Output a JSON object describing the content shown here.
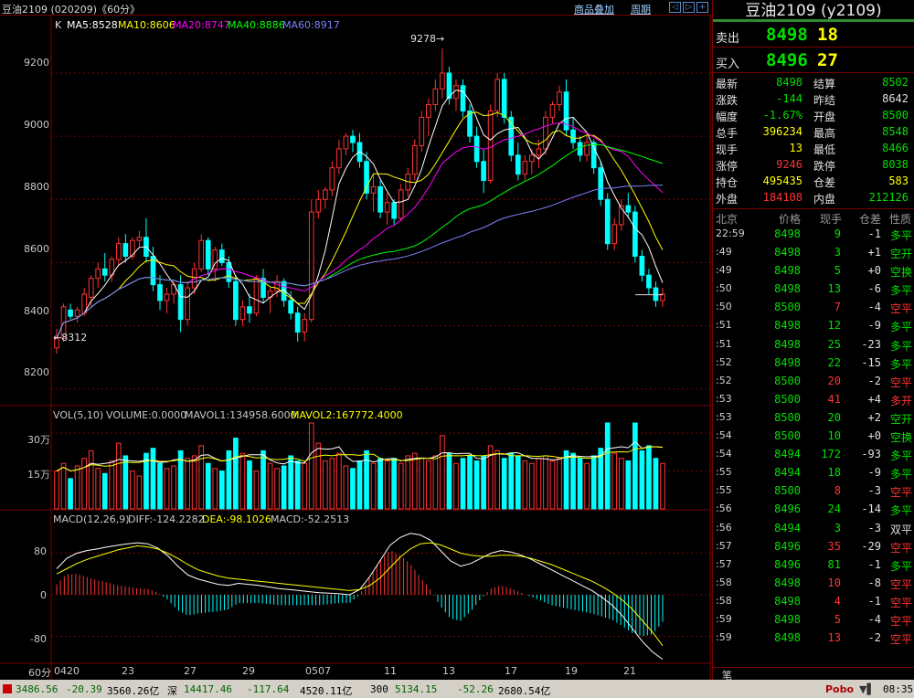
{
  "window": {
    "symbol_line": "豆油2109 (020209)《60分》",
    "menu": [
      "商品叠加",
      "周期"
    ],
    "nav_buttons": [
      "◁",
      "▷",
      "+",
      "−",
      "⊡"
    ]
  },
  "price_chart": {
    "type_label": "K",
    "ma_labels": [
      {
        "text": "MA5:8528",
        "color": "#ffffff"
      },
      {
        "text": "MA10:8606",
        "color": "#ffff00"
      },
      {
        "text": "MA20:8747",
        "color": "#ff00ff"
      },
      {
        "text": "MA40:8886",
        "color": "#00ff00"
      },
      {
        "text": "MA60:8917",
        "color": "#8080ff"
      }
    ],
    "y_ticks": [
      "9200",
      "9000",
      "8800",
      "8600",
      "8400",
      "8200"
    ],
    "high_marker": "9278→",
    "low_marker": "←8312"
  },
  "volume_chart": {
    "labels": [
      {
        "text": "VOL(5,10)",
        "color": "#e0e0e0"
      },
      {
        "text": "VOLUME:0.0000",
        "color": "#e0e0e0"
      },
      {
        "text": "MAVOL1:134958.6000",
        "color": "#e0e0e0"
      },
      {
        "text": "MAVOL2:167772.4000",
        "color": "#ffff00"
      }
    ],
    "y_ticks": [
      "30万",
      "15万"
    ]
  },
  "macd_chart": {
    "labels": [
      {
        "text": "MACD(12,26,9)",
        "color": "#e0e0e0"
      },
      {
        "text": "DIFF:-124.2282",
        "color": "#e0e0e0"
      },
      {
        "text": "DEA:-98.1026",
        "color": "#ffff00"
      },
      {
        "text": "MACD:-52.2513",
        "color": "#e0e0e0"
      }
    ],
    "y_ticks": [
      "80",
      "0",
      "-80"
    ]
  },
  "x_axis": {
    "period": "60分",
    "ticks": [
      "0420",
      "23",
      "27",
      "29",
      "0507",
      "11",
      "13",
      "17",
      "19",
      "21"
    ]
  },
  "colors": {
    "up": "#ff3232",
    "down": "#00ffff",
    "grid": "#7a0000",
    "green_value": "#00e000",
    "red_value": "#ff3232",
    "yellow_value": "#ffff00"
  },
  "chart_data": {
    "type": "candlestick",
    "interval": "60分",
    "ylim": [
      8150,
      9330
    ],
    "candles": [
      [
        8330,
        8390,
        8312,
        8360
      ],
      [
        8360,
        8470,
        8350,
        8460
      ],
      [
        8450,
        8470,
        8420,
        8430
      ],
      [
        8430,
        8460,
        8410,
        8450
      ],
      [
        8440,
        8520,
        8430,
        8500
      ],
      [
        8490,
        8560,
        8460,
        8550
      ],
      [
        8550,
        8600,
        8520,
        8580
      ],
      [
        8580,
        8630,
        8540,
        8560
      ],
      [
        8560,
        8620,
        8540,
        8610
      ],
      [
        8610,
        8680,
        8590,
        8660
      ],
      [
        8660,
        8690,
        8600,
        8620
      ],
      [
        8620,
        8680,
        8610,
        8670
      ],
      [
        8670,
        8700,
        8650,
        8680
      ],
      [
        8680,
        8740,
        8600,
        8620
      ],
      [
        8620,
        8650,
        8510,
        8530
      ],
      [
        8530,
        8560,
        8450,
        8480
      ],
      [
        8480,
        8520,
        8440,
        8500
      ],
      [
        8500,
        8540,
        8470,
        8530
      ],
      [
        8530,
        8560,
        8380,
        8420
      ],
      [
        8420,
        8540,
        8400,
        8520
      ],
      [
        8520,
        8600,
        8500,
        8580
      ],
      [
        8580,
        8690,
        8570,
        8670
      ],
      [
        8670,
        8680,
        8560,
        8580
      ],
      [
        8580,
        8650,
        8540,
        8640
      ],
      [
        8640,
        8660,
        8590,
        8600
      ],
      [
        8600,
        8620,
        8520,
        8540
      ],
      [
        8540,
        8560,
        8400,
        8420
      ],
      [
        8420,
        8480,
        8400,
        8460
      ],
      [
        8460,
        8500,
        8410,
        8440
      ],
      [
        8440,
        8560,
        8430,
        8550
      ],
      [
        8550,
        8580,
        8470,
        8490
      ],
      [
        8490,
        8520,
        8440,
        8510
      ],
      [
        8510,
        8560,
        8490,
        8540
      ],
      [
        8540,
        8550,
        8460,
        8480
      ],
      [
        8480,
        8510,
        8420,
        8440
      ],
      [
        8440,
        8460,
        8350,
        8380
      ],
      [
        8380,
        8440,
        8350,
        8420
      ],
      [
        8420,
        8800,
        8410,
        8760
      ],
      [
        8760,
        8830,
        8740,
        8800
      ],
      [
        8800,
        8840,
        8770,
        8830
      ],
      [
        8830,
        8920,
        8810,
        8900
      ],
      [
        8900,
        8990,
        8880,
        8960
      ],
      [
        8960,
        9010,
        8940,
        9000
      ],
      [
        9000,
        9020,
        8950,
        8980
      ],
      [
        8980,
        9010,
        8900,
        8920
      ],
      [
        8920,
        8950,
        8800,
        8820
      ],
      [
        8820,
        8880,
        8760,
        8840
      ],
      [
        8840,
        8860,
        8740,
        8760
      ],
      [
        8760,
        8820,
        8720,
        8790
      ],
      [
        8790,
        8800,
        8720,
        8740
      ],
      [
        8740,
        8850,
        8730,
        8830
      ],
      [
        8830,
        8900,
        8810,
        8880
      ],
      [
        8880,
        8990,
        8860,
        8970
      ],
      [
        8970,
        9080,
        8950,
        9060
      ],
      [
        9060,
        9120,
        9000,
        9100
      ],
      [
        9100,
        9180,
        9080,
        9150
      ],
      [
        9150,
        9278,
        9120,
        9200
      ],
      [
        9200,
        9220,
        9100,
        9120
      ],
      [
        9120,
        9180,
        9080,
        9160
      ],
      [
        9160,
        9180,
        9060,
        9080
      ],
      [
        9080,
        9100,
        8980,
        9000
      ],
      [
        9000,
        9030,
        8900,
        8920
      ],
      [
        8920,
        8960,
        8820,
        8860
      ],
      [
        8860,
        9100,
        8850,
        9080
      ],
      [
        9080,
        9200,
        9060,
        9180
      ],
      [
        9180,
        9200,
        9040,
        9060
      ],
      [
        9060,
        9080,
        8920,
        8940
      ],
      [
        8940,
        8980,
        8860,
        8880
      ],
      [
        8880,
        8940,
        8860,
        8920
      ],
      [
        8920,
        8960,
        8880,
        8940
      ],
      [
        8940,
        8990,
        8900,
        8960
      ],
      [
        8960,
        9080,
        8940,
        9060
      ],
      [
        9060,
        9110,
        9040,
        9100
      ],
      [
        9100,
        9160,
        9080,
        9140
      ],
      [
        9140,
        9180,
        9000,
        9020
      ],
      [
        9020,
        9060,
        8960,
        8980
      ],
      [
        8980,
        9000,
        8920,
        8940
      ],
      [
        8940,
        9000,
        8920,
        8980
      ],
      [
        8980,
        8990,
        8880,
        8900
      ],
      [
        8900,
        8920,
        8780,
        8800
      ],
      [
        8800,
        8820,
        8640,
        8660
      ],
      [
        8660,
        8740,
        8640,
        8720
      ],
      [
        8720,
        8800,
        8700,
        8780
      ],
      [
        8780,
        8820,
        8740,
        8760
      ],
      [
        8760,
        8780,
        8600,
        8620
      ],
      [
        8620,
        8640,
        8540,
        8560
      ],
      [
        8560,
        8580,
        8500,
        8520
      ],
      [
        8520,
        8540,
        8460,
        8480
      ],
      [
        8480,
        8520,
        8460,
        8500
      ]
    ],
    "ma_series": [
      {
        "name": "MA5",
        "color": "#ffffff"
      },
      {
        "name": "MA10",
        "color": "#ffff00"
      },
      {
        "name": "MA20",
        "color": "#ff00ff"
      },
      {
        "name": "MA40",
        "color": "#00ff00"
      },
      {
        "name": "MA60",
        "color": "#8080ff"
      }
    ],
    "volume_ylim": [
      0,
      340000
    ],
    "volume": [
      150000,
      180000,
      120000,
      170000,
      200000,
      230000,
      160000,
      140000,
      190000,
      260000,
      210000,
      150000,
      130000,
      220000,
      240000,
      180000,
      160000,
      170000,
      230000,
      200000,
      210000,
      250000,
      180000,
      160000,
      150000,
      230000,
      280000,
      220000,
      190000,
      150000,
      230000,
      180000,
      160000,
      170000,
      210000,
      190000,
      180000,
      360000,
      260000,
      190000,
      200000,
      220000,
      170000,
      160000,
      190000,
      230000,
      180000,
      200000,
      190000,
      200000,
      180000,
      210000,
      220000,
      200000,
      190000,
      210000,
      290000,
      220000,
      180000,
      200000,
      210000,
      190000,
      210000,
      250000,
      230000,
      200000,
      220000,
      210000,
      190000,
      180000,
      200000,
      210000,
      190000,
      200000,
      230000,
      220000,
      200000,
      180000,
      210000,
      240000,
      360000,
      220000,
      200000,
      190000,
      360000,
      230000,
      250000,
      200000,
      180000
    ],
    "macd_ylim": [
      -130,
      130
    ],
    "diff": [
      50,
      70,
      80,
      85,
      88,
      92,
      95,
      98,
      100,
      98,
      90,
      75,
      55,
      38,
      30,
      25,
      20,
      18,
      22,
      20,
      18,
      15,
      12,
      10,
      8,
      6,
      4,
      3,
      2,
      0,
      10,
      35,
      65,
      95,
      110,
      118,
      115,
      105,
      85,
      65,
      55,
      60,
      70,
      80,
      85,
      82,
      76,
      68,
      58,
      48,
      38,
      28,
      18,
      8,
      -5,
      -20,
      -40,
      -65,
      -90,
      -110,
      -124
    ],
    "dea": [
      40,
      50,
      60,
      68,
      74,
      80,
      86,
      90,
      94,
      92,
      88,
      80,
      70,
      58,
      48,
      42,
      36,
      32,
      30,
      28,
      26,
      24,
      22,
      20,
      18,
      16,
      14,
      12,
      10,
      8,
      10,
      18,
      32,
      52,
      72,
      88,
      98,
      100,
      96,
      88,
      80,
      76,
      74,
      74,
      76,
      76,
      74,
      70,
      64,
      58,
      50,
      42,
      34,
      26,
      16,
      4,
      -10,
      -28,
      -50,
      -72,
      -98
    ]
  },
  "quote_panel": {
    "title": "豆油2109 (y2109)",
    "ask": {
      "label": "卖出",
      "price": "8498",
      "volume": "18"
    },
    "bid": {
      "label": "买入",
      "price": "8496",
      "volume": "27"
    },
    "stats": [
      {
        "l1": "最新",
        "v1": "8498",
        "c1": "#00e000",
        "l2": "结算",
        "v2": "8502",
        "c2": "#00e000"
      },
      {
        "l1": "涨跌",
        "v1": "-144",
        "c1": "#00e000",
        "l2": "昨结",
        "v2": "8642",
        "c2": "#e0e0e0"
      },
      {
        "l1": "幅度",
        "v1": "-1.67%",
        "c1": "#00e000",
        "l2": "开盘",
        "v2": "8500",
        "c2": "#00e000"
      },
      {
        "l1": "总手",
        "v1": "396234",
        "c1": "#ffff00",
        "l2": "最高",
        "v2": "8548",
        "c2": "#00e000"
      },
      {
        "l1": "现手",
        "v1": "13",
        "c1": "#ffff00",
        "l2": "最低",
        "v2": "8466",
        "c2": "#00e000"
      },
      {
        "l1": "涨停",
        "v1": "9246",
        "c1": "#ff3232",
        "l2": "跌停",
        "v2": "8038",
        "c2": "#00e000"
      },
      {
        "l1": "持仓",
        "v1": "495435",
        "c1": "#ffff00",
        "l2": "仓差",
        "v2": "583",
        "c2": "#ffff00"
      },
      {
        "l1": "外盘",
        "v1": "184108",
        "c1": "#ff3232",
        "l2": "内盘",
        "v2": "212126",
        "c2": "#00e000"
      }
    ],
    "tick_header": [
      "北京",
      "价格",
      "现手",
      "仓差",
      "性质"
    ],
    "ticks": [
      {
        "time": "22:59",
        "price": "8498",
        "qty": "9",
        "qc": "#00e000",
        "oi": "-1",
        "nature": "多平",
        "nc": "#00e000"
      },
      {
        "time": ":49",
        "price": "8498",
        "qty": "3",
        "qc": "#00e000",
        "oi": "+1",
        "nature": "空开",
        "nc": "#00e000"
      },
      {
        "time": ":49",
        "price": "8498",
        "qty": "5",
        "qc": "#00e000",
        "oi": "+0",
        "nature": "空换",
        "nc": "#00e000"
      },
      {
        "time": ":50",
        "price": "8498",
        "qty": "13",
        "qc": "#00e000",
        "oi": "-6",
        "nature": "多平",
        "nc": "#00e000"
      },
      {
        "time": ":50",
        "price": "8500",
        "qty": "7",
        "qc": "#ff3232",
        "oi": "-4",
        "nature": "空平",
        "nc": "#ff3232"
      },
      {
        "time": ":51",
        "price": "8498",
        "qty": "12",
        "qc": "#00e000",
        "oi": "-9",
        "nature": "多平",
        "nc": "#00e000"
      },
      {
        "time": ":51",
        "price": "8498",
        "qty": "25",
        "qc": "#00e000",
        "oi": "-23",
        "nature": "多平",
        "nc": "#00e000"
      },
      {
        "time": ":52",
        "price": "8498",
        "qty": "22",
        "qc": "#00e000",
        "oi": "-15",
        "nature": "多平",
        "nc": "#00e000"
      },
      {
        "time": ":52",
        "price": "8500",
        "qty": "20",
        "qc": "#ff3232",
        "oi": "-2",
        "nature": "空平",
        "nc": "#ff3232"
      },
      {
        "time": ":53",
        "price": "8500",
        "qty": "41",
        "qc": "#ff3232",
        "oi": "+4",
        "nature": "多开",
        "nc": "#ff3232"
      },
      {
        "time": ":53",
        "price": "8500",
        "qty": "20",
        "qc": "#00e000",
        "oi": "+2",
        "nature": "空开",
        "nc": "#00e000"
      },
      {
        "time": ":54",
        "price": "8500",
        "qty": "10",
        "qc": "#00e000",
        "oi": "+0",
        "nature": "空换",
        "nc": "#00e000"
      },
      {
        "time": ":54",
        "price": "8494",
        "qty": "172",
        "qc": "#00e000",
        "oi": "-93",
        "nature": "多平",
        "nc": "#00e000"
      },
      {
        "time": ":55",
        "price": "8494",
        "qty": "18",
        "qc": "#00e000",
        "oi": "-9",
        "nature": "多平",
        "nc": "#00e000"
      },
      {
        "time": ":55",
        "price": "8500",
        "qty": "8",
        "qc": "#ff3232",
        "oi": "-3",
        "nature": "空平",
        "nc": "#ff3232"
      },
      {
        "time": ":56",
        "price": "8496",
        "qty": "24",
        "qc": "#00e000",
        "oi": "-14",
        "nature": "多平",
        "nc": "#00e000"
      },
      {
        "time": ":56",
        "price": "8494",
        "qty": "3",
        "qc": "#00e000",
        "oi": "-3",
        "nature": "双平",
        "nc": "#e0e0e0"
      },
      {
        "time": ":57",
        "price": "8496",
        "qty": "35",
        "qc": "#ff3232",
        "oi": "-29",
        "nature": "空平",
        "nc": "#ff3232"
      },
      {
        "time": ":57",
        "price": "8496",
        "qty": "81",
        "qc": "#00e000",
        "oi": "-1",
        "nature": "多平",
        "nc": "#00e000"
      },
      {
        "time": ":58",
        "price": "8498",
        "qty": "10",
        "qc": "#ff3232",
        "oi": "-8",
        "nature": "空平",
        "nc": "#ff3232"
      },
      {
        "time": ":58",
        "price": "8498",
        "qty": "4",
        "qc": "#ff3232",
        "oi": "-1",
        "nature": "空平",
        "nc": "#ff3232"
      },
      {
        "time": ":59",
        "price": "8498",
        "qty": "5",
        "qc": "#ff3232",
        "oi": "-4",
        "nature": "空平",
        "nc": "#ff3232"
      },
      {
        "time": ":59",
        "price": "8498",
        "qty": "13",
        "qc": "#ff3232",
        "oi": "-2",
        "nature": "空平",
        "nc": "#ff3232"
      }
    ],
    "footer_tab": "笔"
  },
  "status_bar": {
    "items": [
      {
        "text": "3486.56",
        "color": "#006400"
      },
      {
        "text": "-20.39",
        "color": "#006400"
      },
      {
        "text": "3560.26亿",
        "color": "#000000"
      },
      {
        "text": "深",
        "color": "#000000"
      },
      {
        "text": "14417.46",
        "color": "#006400"
      },
      {
        "text": "-117.64",
        "color": "#006400"
      },
      {
        "text": "4520.11亿",
        "color": "#000000"
      },
      {
        "text": "300",
        "color": "#000000"
      },
      {
        "text": "5134.15",
        "color": "#006400"
      },
      {
        "text": "-52.26",
        "color": "#006400"
      },
      {
        "text": "2680.54亿",
        "color": "#000000"
      }
    ],
    "brand": "Pobo",
    "clock": "08:35"
  }
}
